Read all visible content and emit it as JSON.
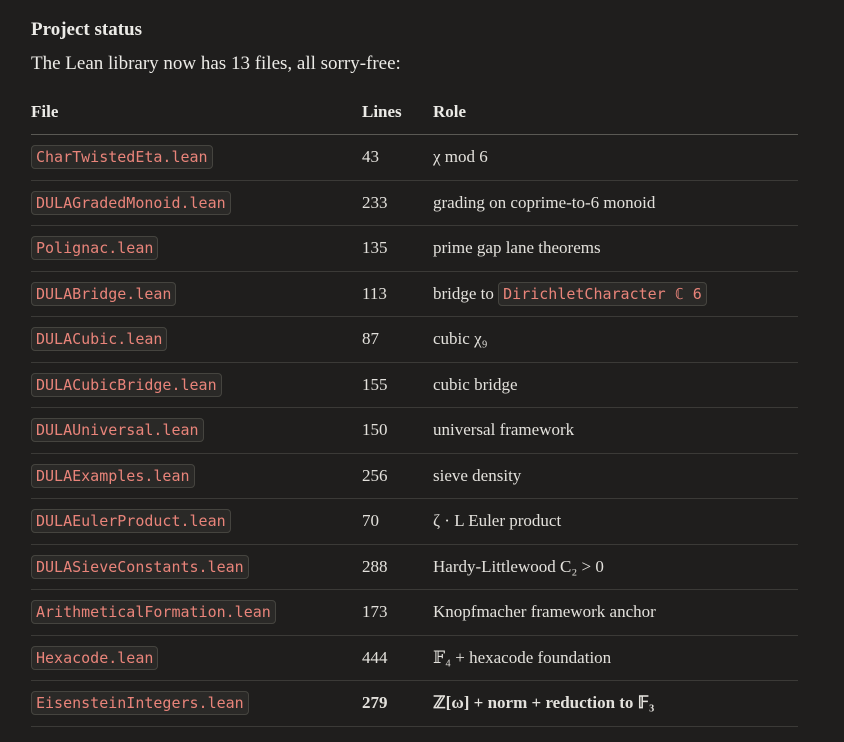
{
  "heading": "Project status",
  "intro": "The Lean library now has 13 files, all sorry-free:",
  "table": {
    "headers": [
      "File",
      "Lines",
      "Role"
    ],
    "rows": [
      {
        "file": "CharTwistedEta.lean",
        "lines": "43",
        "role": "χ mod 6"
      },
      {
        "file": "DULAGradedMonoid.lean",
        "lines": "233",
        "role": "grading on coprime-to-6 monoid"
      },
      {
        "file": "Polignac.lean",
        "lines": "135",
        "role": "prime gap lane theorems"
      },
      {
        "file": "DULABridge.lean",
        "lines": "113",
        "role_prefix": "bridge to ",
        "role_code": "DirichletCharacter ℂ 6"
      },
      {
        "file": "DULACubic.lean",
        "lines": "87",
        "role": "cubic χ₉"
      },
      {
        "file": "DULACubicBridge.lean",
        "lines": "155",
        "role": "cubic bridge"
      },
      {
        "file": "DULAUniversal.lean",
        "lines": "150",
        "role": "universal framework"
      },
      {
        "file": "DULAExamples.lean",
        "lines": "256",
        "role": "sieve density"
      },
      {
        "file": "DULAEulerProduct.lean",
        "lines": "70",
        "role": "ζ · L Euler product"
      },
      {
        "file": "DULASieveConstants.lean",
        "lines": "288",
        "role": "Hardy-Littlewood C₂ > 0"
      },
      {
        "file": "ArithmeticalFormation.lean",
        "lines": "173",
        "role": "Knopfmacher framework anchor"
      },
      {
        "file": "Hexacode.lean",
        "lines": "444",
        "role": "𝔽₄ + hexacode foundation"
      },
      {
        "file": "EisensteinIntegers.lean",
        "lines": "279",
        "role": "ℤ[ω] + norm + reduction to 𝔽₃",
        "bold": true
      }
    ]
  }
}
